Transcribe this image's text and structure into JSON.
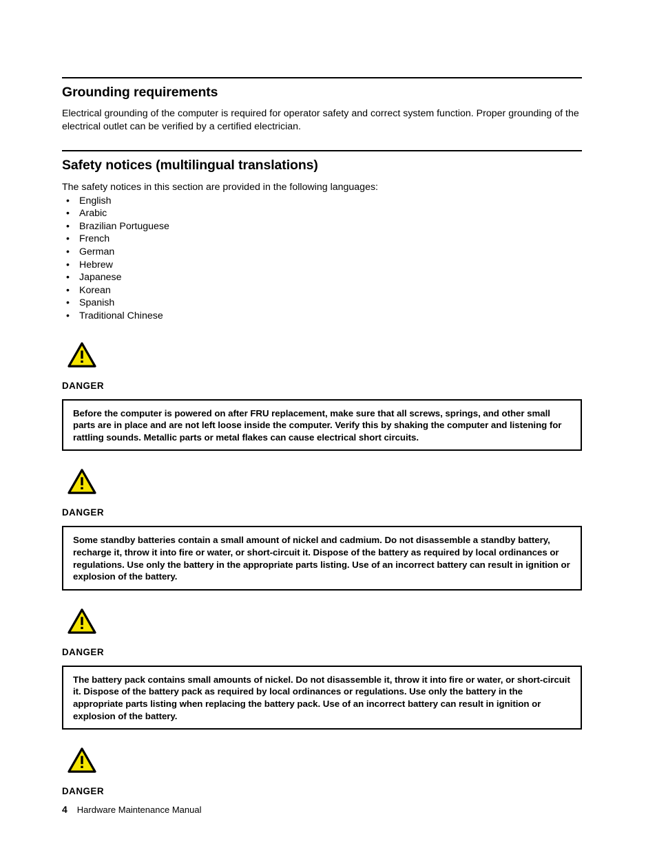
{
  "document": {
    "sections": [
      {
        "heading": "Grounding requirements",
        "paragraph": "Electrical grounding of the computer is required for operator safety and correct system function.  Proper grounding of the electrical outlet can be verified by a certified electrician."
      },
      {
        "heading": "Safety notices (multilingual translations)",
        "intro": "The safety notices in this section are provided in the following languages:",
        "languages": [
          "English",
          "Arabic",
          "Brazilian Portuguese",
          "French",
          "German",
          "Hebrew",
          "Japanese",
          "Korean",
          "Spanish",
          "Traditional Chinese"
        ]
      }
    ],
    "bullet_glyph": "•",
    "warnings": [
      {
        "icon": "warning-triangle-icon",
        "label": "DANGER",
        "text": "Before the computer is powered on after FRU replacement, make sure that all screws, springs, and other small parts are in place and are not left loose inside the computer.  Verify this by shaking the computer and listening for rattling sounds.  Metallic parts or metal flakes can cause electrical short circuits."
      },
      {
        "icon": "warning-triangle-icon",
        "label": "DANGER",
        "text": "Some standby batteries contain a small amount of nickel and cadmium.  Do not disassemble a standby battery, recharge it, throw it into fire or water, or short-circuit it.  Dispose of the battery as required by local ordinances or regulations.  Use only the battery in the appropriate parts listing.  Use of an incorrect battery can result in ignition or explosion of the battery."
      },
      {
        "icon": "warning-triangle-icon",
        "label": "DANGER",
        "text": "The battery pack contains small amounts of nickel.  Do not disassemble it, throw it into fire or water, or short-circuit it.  Dispose of the battery pack as required by local ordinances or regulations.  Use only the battery in the appropriate parts listing when replacing the battery pack.  Use of an incorrect battery can result in ignition or explosion of the battery."
      },
      {
        "icon": "warning-triangle-icon",
        "label": "DANGER",
        "text": null
      }
    ],
    "footer": {
      "page_number": "4",
      "title": "Hardware Maintenance Manual"
    },
    "colors": {
      "warning_fill": "#F5E400",
      "warning_stroke": "#000000",
      "text": "#000000",
      "background": "#FFFFFF"
    }
  }
}
